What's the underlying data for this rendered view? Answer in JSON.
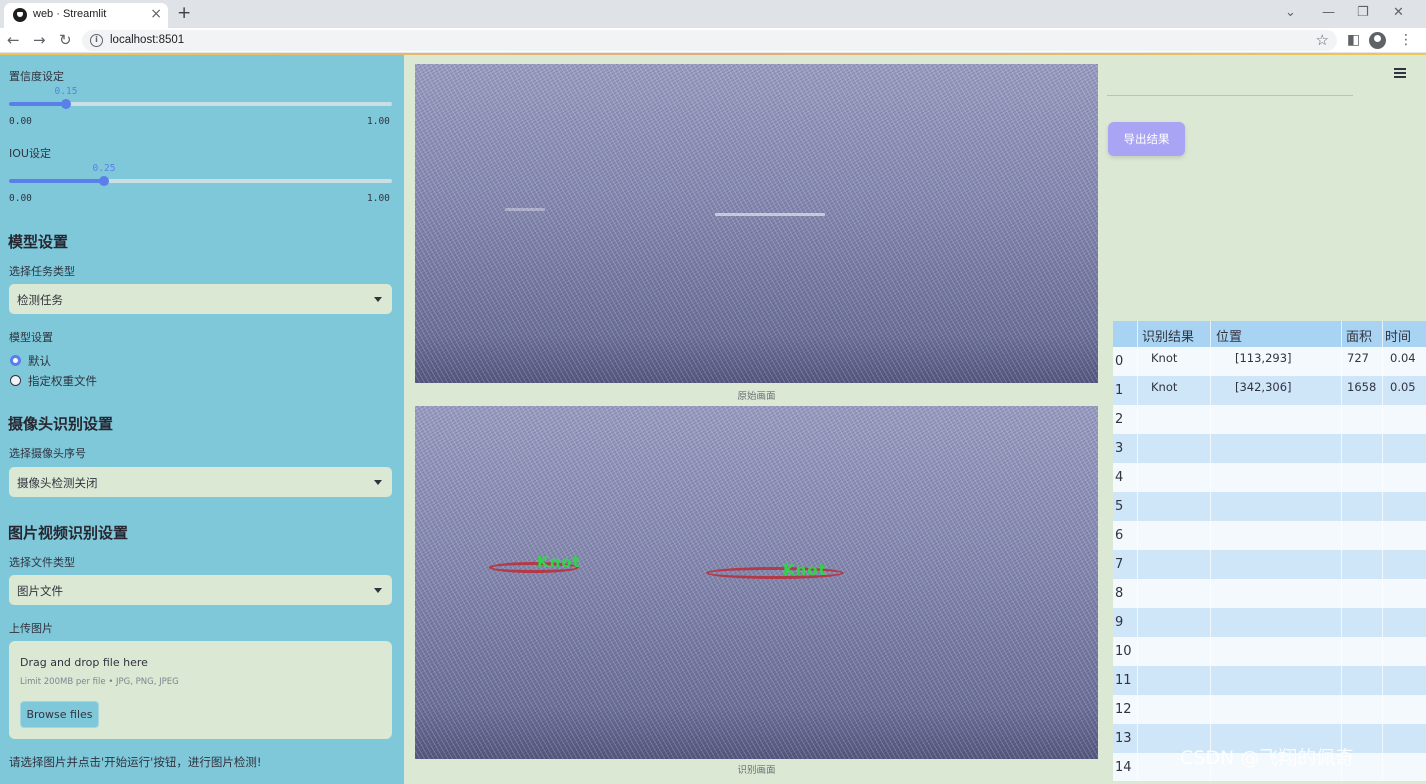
{
  "browser": {
    "tab_title": "web · Streamlit",
    "url": "localhost:8501"
  },
  "sidebar": {
    "confidence": {
      "label": "置信度设定",
      "value": 0.15,
      "value_text": "0.15",
      "min": "0.00",
      "max": "1.00"
    },
    "iou": {
      "label": "IOU设定",
      "value": 0.25,
      "value_text": "0.25",
      "min": "0.00",
      "max": "1.00"
    },
    "model_section": "模型设置",
    "task_type_label": "选择任务类型",
    "task_type_value": "检测任务",
    "model_settings_label": "模型设置",
    "model_options": [
      "默认",
      "指定权重文件"
    ],
    "model_selected": "默认",
    "camera_section": "摄像头识别设置",
    "camera_label": "选择摄像头序号",
    "camera_value": "摄像头检测关闭",
    "media_section": "图片视频识别设置",
    "file_type_label": "选择文件类型",
    "file_type_value": "图片文件",
    "upload_label": "上传图片",
    "uploader": {
      "title": "Drag and drop file here",
      "limit": "Limit 200MB per file • JPG, PNG, JPEG",
      "button": "Browse files"
    },
    "hint": "请选择图片并点击'开始运行'按钮，进行图片检测!"
  },
  "main": {
    "original_caption": "原始画面",
    "result_caption": "识别画面",
    "detections": [
      {
        "label": "Knot"
      },
      {
        "label": "Knot"
      }
    ],
    "export_button": "导出结果"
  },
  "table": {
    "columns": [
      "识别结果",
      "位置",
      "面积",
      "时间"
    ],
    "rows": [
      {
        "idx": "0",
        "result": "Knot",
        "position": "[113,293]",
        "area": "727",
        "time": "0.04"
      },
      {
        "idx": "1",
        "result": "Knot",
        "position": "[342,306]",
        "area": "1658",
        "time": "0.05"
      },
      {
        "idx": "2",
        "result": "",
        "position": "",
        "area": "",
        "time": ""
      },
      {
        "idx": "3",
        "result": "",
        "position": "",
        "area": "",
        "time": ""
      },
      {
        "idx": "4",
        "result": "",
        "position": "",
        "area": "",
        "time": ""
      },
      {
        "idx": "5",
        "result": "",
        "position": "",
        "area": "",
        "time": ""
      },
      {
        "idx": "6",
        "result": "",
        "position": "",
        "area": "",
        "time": ""
      },
      {
        "idx": "7",
        "result": "",
        "position": "",
        "area": "",
        "time": ""
      },
      {
        "idx": "8",
        "result": "",
        "position": "",
        "area": "",
        "time": ""
      },
      {
        "idx": "9",
        "result": "",
        "position": "",
        "area": "",
        "time": ""
      },
      {
        "idx": "10",
        "result": "",
        "position": "",
        "area": "",
        "time": ""
      },
      {
        "idx": "11",
        "result": "",
        "position": "",
        "area": "",
        "time": ""
      },
      {
        "idx": "12",
        "result": "",
        "position": "",
        "area": "",
        "time": ""
      },
      {
        "idx": "13",
        "result": "",
        "position": "",
        "area": "",
        "time": ""
      },
      {
        "idx": "14",
        "result": "",
        "position": "",
        "area": "",
        "time": ""
      }
    ]
  },
  "watermark": "CSDN @飞翔的佩奇",
  "colors": {
    "sidebar_bg": "#7ec8da",
    "main_bg": "#dbe8d3",
    "slider_accent": "#5a7fe8",
    "export_button": "#a9a4f4",
    "table_header": "#a8d3f2",
    "detection_box": "#b23a48",
    "detection_label": "#2fd44a"
  }
}
